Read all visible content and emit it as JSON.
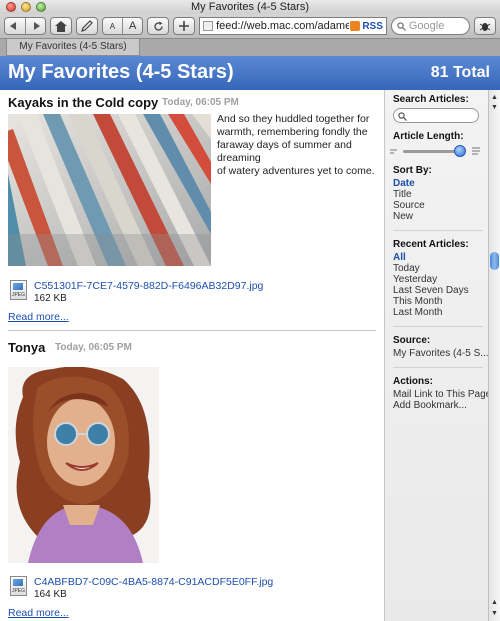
{
  "window": {
    "title": "My Favorites (4-5 Stars)"
  },
  "toolbar": {
    "back_icon": "back-arrow-icon",
    "forward_icon": "forward-arrow-icon",
    "home_icon": "home-icon",
    "edit_icon": "pencil-icon",
    "text_smaller": "A",
    "text_larger": "A",
    "reload_icon": "reload-icon",
    "add_icon": "plus-icon",
    "url": "feed://web.mac.com/adamen",
    "rss_label": "RSS",
    "search_placeholder": "Google"
  },
  "tab": {
    "label": "My Favorites (4-5 Stars)"
  },
  "header": {
    "title": "My Favorites (4-5 Stars)",
    "total": "81 Total"
  },
  "articles": [
    {
      "title": "Kayaks in the Cold copy",
      "date": "Today, 06:05 PM",
      "text_lines": [
        "And so they huddled together for",
        "warmth, remembering fondly the",
        "faraway days of summer and dreaming",
        "of watery adventures yet to come."
      ],
      "file_name": "C551301F-7CE7-4579-882D-F6496AB32D97.jpg",
      "file_size": "162 KB",
      "read_more": "Read more..."
    },
    {
      "title": "Tonya",
      "date": "Today, 06:05 PM",
      "file_name": "C4ABFBD7-C09C-4BA5-8874-C91ACDF5E0FF.jpg",
      "file_size": "164 KB",
      "read_more": "Read more..."
    }
  ],
  "sidebar": {
    "search_heading": "Search Articles:",
    "length_heading": "Article Length:",
    "article_length": 0.95,
    "sort_heading": "Sort By:",
    "sort_options": [
      "Date",
      "Title",
      "Source",
      "New"
    ],
    "recent_heading": "Recent Articles:",
    "recent_options": [
      "All",
      "Today",
      "Yesterday",
      "Last Seven Days",
      "This Month",
      "Last Month"
    ],
    "source_heading": "Source:",
    "source_value": "My Favorites (4-5 S...",
    "actions_heading": "Actions:",
    "actions": [
      "Mail Link to This Page",
      "Add Bookmark..."
    ]
  },
  "colors": {
    "header_blue": "#4677c6",
    "link_blue": "#1d4fb0",
    "date_gray": "#a0a0a0"
  }
}
